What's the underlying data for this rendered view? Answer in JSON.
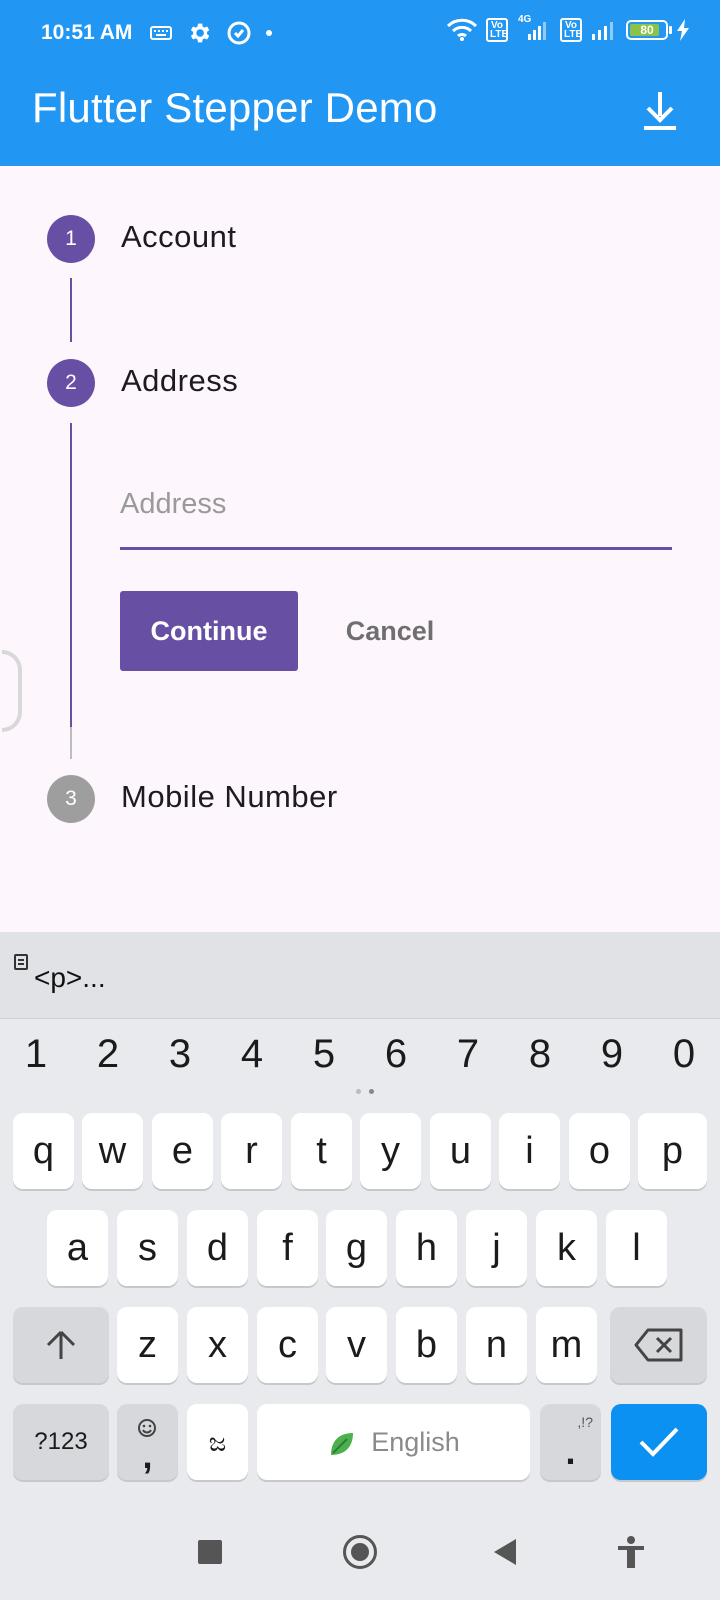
{
  "status_bar": {
    "time": "10:51 AM",
    "network_label": "4G",
    "volte_label_1": "Vo LTE",
    "volte_label_2": "Vo LTE",
    "battery_level": "80",
    "colors": {
      "background": "#2196f3",
      "battery_fill": "#8bc34a"
    }
  },
  "app_bar": {
    "title": "Flutter Stepper Demo",
    "action_icon": "download-icon"
  },
  "stepper": {
    "steps": [
      {
        "number": "1",
        "title": "Account",
        "state": "active"
      },
      {
        "number": "2",
        "title": "Address",
        "state": "active"
      },
      {
        "number": "3",
        "title": "Mobile Number",
        "state": "inactive"
      }
    ],
    "address_field": {
      "placeholder": "Address",
      "value": ""
    },
    "continue_label": "Continue",
    "cancel_label": "Cancel",
    "colors": {
      "active": "#6750a4",
      "inactive": "#9e9e9e"
    }
  },
  "keyboard": {
    "suggestion": "<p>...",
    "number_row": [
      "1",
      "2",
      "3",
      "4",
      "5",
      "6",
      "7",
      "8",
      "9",
      "0"
    ],
    "row1": [
      "q",
      "w",
      "e",
      "r",
      "t",
      "y",
      "u",
      "i",
      "o",
      "p"
    ],
    "row2": [
      "a",
      "s",
      "d",
      "f",
      "g",
      "h",
      "j",
      "k",
      "l"
    ],
    "row3": [
      "z",
      "x",
      "c",
      "v",
      "b",
      "n",
      "m"
    ],
    "symbols_label": "?123",
    "emoji_comma": ",",
    "language_key": "ಜ",
    "space_label": "English",
    "period_key": ".",
    "period_hint": ",!?",
    "done_color": "#0a91f2"
  },
  "nav_bar": {
    "icons": [
      "recents-icon",
      "home-icon",
      "back-icon",
      "accessibility-icon"
    ]
  }
}
